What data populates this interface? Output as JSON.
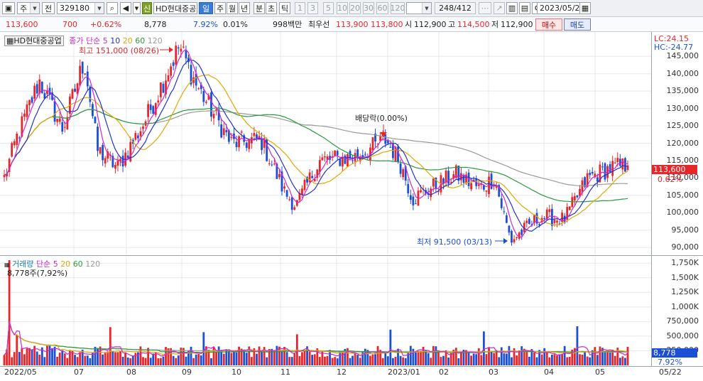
{
  "toolbar": {
    "period": "주",
    "period_alt": "전",
    "code": "329180",
    "tag": "신",
    "stock_name": "HD현대중공",
    "intervals": [
      "일",
      "주",
      "월",
      "년",
      "분",
      "초",
      "틱"
    ],
    "numbers": [
      "1",
      "3",
      "5",
      "10",
      "20",
      "30",
      "60",
      "120"
    ],
    "count": "248/412",
    "date": "2023/05/22"
  },
  "quote": {
    "price": "113,600",
    "change": "700",
    "change_pct": "+0.62%",
    "volume": "8,778",
    "vol_pct": "7.92%",
    "turnover": "0.01%",
    "amount": "998백만",
    "best_label": "최우선",
    "best_ask": "113,900",
    "best_bid": "113,800",
    "open_label": "시",
    "open": "112,900",
    "high_label": "고",
    "high": "114,500",
    "low_label": "저",
    "low": "112,900",
    "buy": "매수",
    "sell": "매도"
  },
  "price_panel": {
    "name": "HD현대중공업",
    "legend_a": "종가 단순",
    "ma": [
      "5",
      "10",
      "20",
      "60",
      "120"
    ],
    "lc": "LC:24.15",
    "hc": "HC:-24.77",
    "high_note": "최고 151,000 (08/26)",
    "low_note": "최저 91,500 (03/13)",
    "dividend_note": "배당락(0.00%)",
    "last_price": "113,600",
    "last_pct": "0.62%",
    "y_ticks": [
      "145,000",
      "140,000",
      "135,000",
      "130,000",
      "125,000",
      "120,000",
      "115,000",
      "110,000",
      "105,000",
      "100,000",
      "95,000",
      "90,000"
    ]
  },
  "volume_panel": {
    "name": "거래량",
    "legend_a": "단순",
    "ma": [
      "5",
      "20",
      "60",
      "120"
    ],
    "peak_note": "8,778주(7,92%)",
    "last_vol": "8,778",
    "last_pct": "7.92%",
    "y_ticks": [
      "1,750K",
      "1,500K",
      "1,250K",
      "1,000K",
      "750,000",
      "500,000",
      "250,000"
    ]
  },
  "x_labels": [
    "2022/05",
    "07",
    "08",
    "09",
    "10",
    "11",
    "12",
    "2023/01",
    "02",
    "03",
    "04",
    "05",
    "05/22"
  ],
  "colors": {
    "up": "#e8262a",
    "down": "#1a4fd6",
    "ma5": "#d126d1",
    "ma10": "#2233cc",
    "ma20": "#e0a800",
    "ma60": "#2a9a3c",
    "ma120": "#9a9a9a"
  },
  "chart_data": {
    "type": "candlestick",
    "title": "HD현대중공업",
    "ylim": [
      88000,
      152000
    ],
    "volume_ylim": [
      0,
      1850000
    ],
    "anchors": [
      {
        "date": "2022/05/13",
        "close": 110000
      },
      {
        "date": "2022/05/20",
        "close": 121000
      },
      {
        "date": "2022/06/03",
        "close": 138000
      },
      {
        "date": "2022/06/17",
        "close": 124000
      },
      {
        "date": "2022/06/30",
        "close": 144000
      },
      {
        "date": "2022/07/08",
        "close": 118000
      },
      {
        "date": "2022/07/20",
        "close": 113000
      },
      {
        "date": "2022/08/05",
        "close": 126000
      },
      {
        "date": "2022/08/26",
        "close": 148000
      },
      {
        "date": "2022/09/05",
        "close": 137000
      },
      {
        "date": "2022/09/26",
        "close": 120000
      },
      {
        "date": "2022/10/14",
        "close": 121000
      },
      {
        "date": "2022/10/28",
        "close": 106000
      },
      {
        "date": "2022/11/04",
        "close": 102000
      },
      {
        "date": "2022/11/18",
        "close": 115000
      },
      {
        "date": "2022/12/09",
        "close": 116000
      },
      {
        "date": "2022/12/28",
        "close": 121000
      },
      {
        "date": "2023/01/05",
        "close": 115000
      },
      {
        "date": "2023/01/13",
        "close": 104000
      },
      {
        "date": "2023/01/27",
        "close": 108000
      },
      {
        "date": "2023/02/08",
        "close": 111000
      },
      {
        "date": "2023/02/22",
        "close": 107000
      },
      {
        "date": "2023/03/03",
        "close": 110000
      },
      {
        "date": "2023/03/10",
        "close": 97000
      },
      {
        "date": "2023/03/13",
        "close": 92000
      },
      {
        "date": "2023/03/31",
        "close": 99000
      },
      {
        "date": "2023/04/14",
        "close": 98000
      },
      {
        "date": "2023/04/28",
        "close": 110000
      },
      {
        "date": "2023/05/12",
        "close": 113000
      },
      {
        "date": "2023/05/22",
        "close": 113600
      }
    ]
  }
}
